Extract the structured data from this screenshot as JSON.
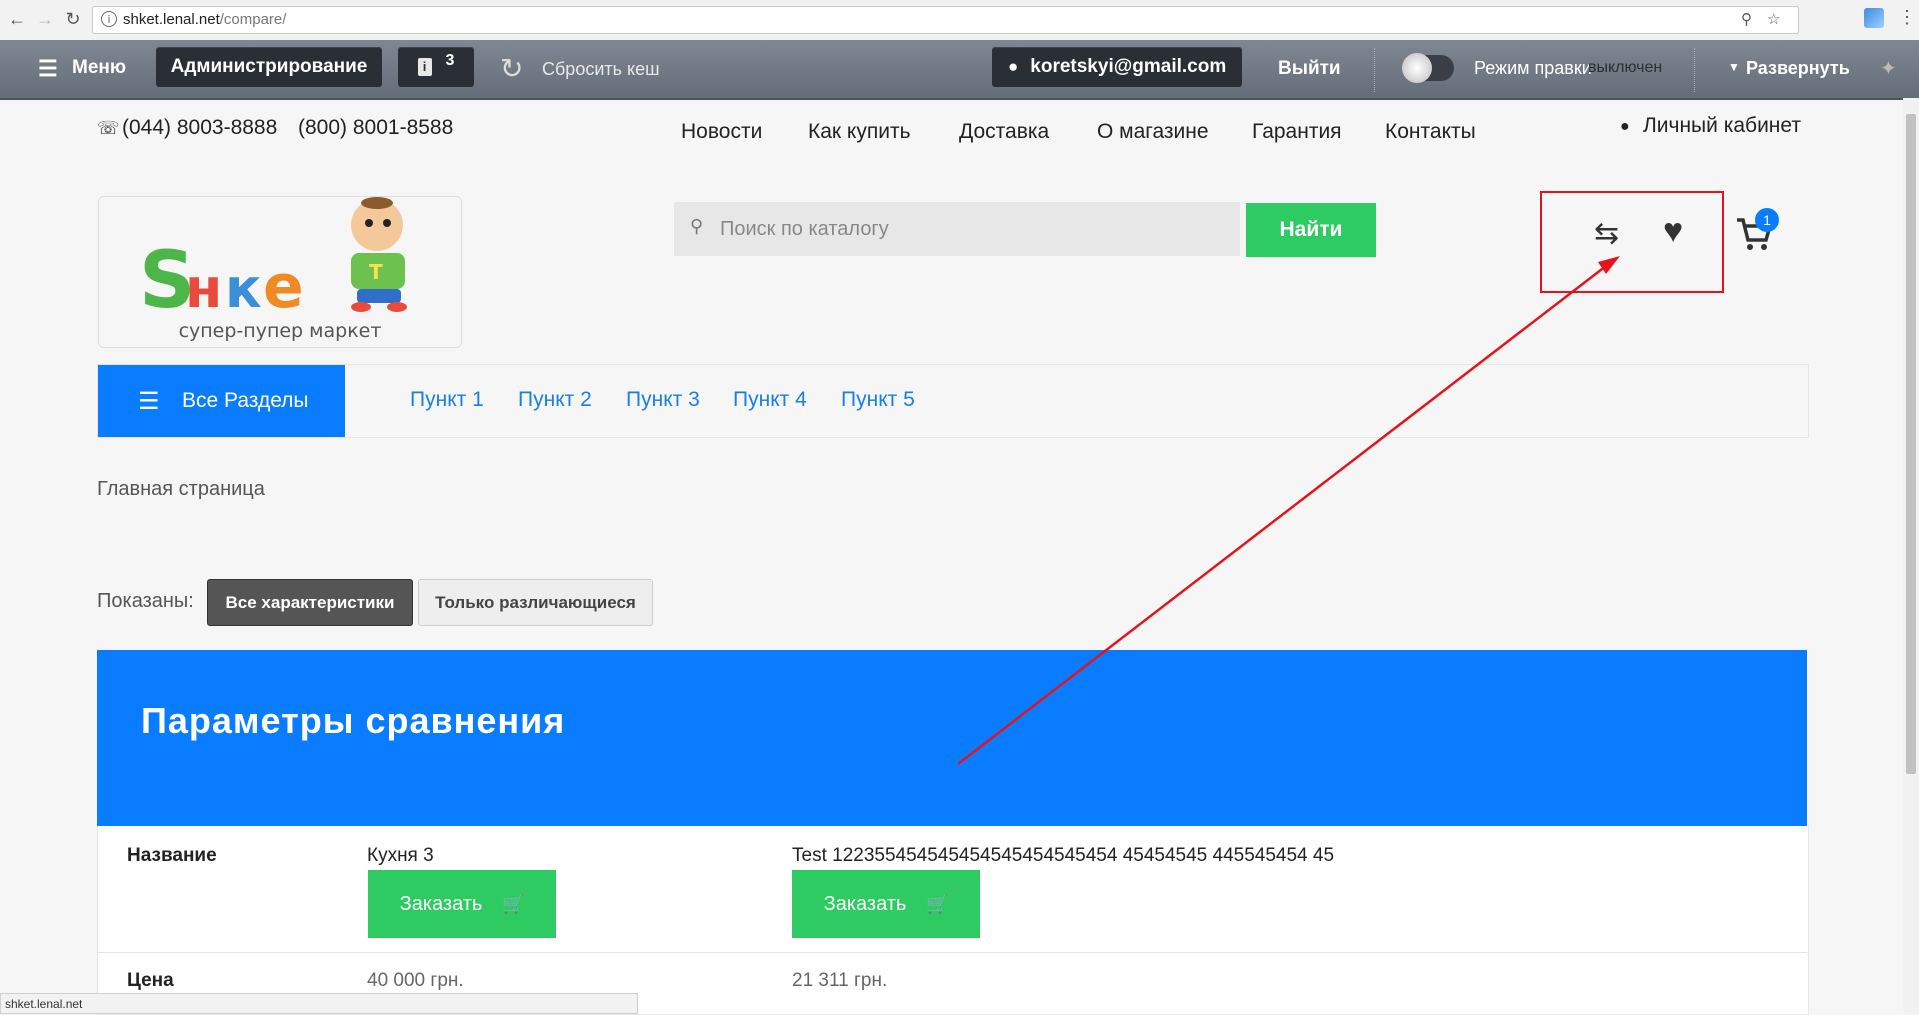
{
  "browser": {
    "url_host": "shket.lenal.net",
    "url_path": "/compare/",
    "status_url": "shket.lenal.net"
  },
  "admin_bar": {
    "menu_label": "Меню",
    "admin_label": "Администрирование",
    "notifications_count": "3",
    "reset_cache_label": "Сбросить кеш",
    "user_email": "koretskyi@gmail.com",
    "logout_label": "Выйти",
    "edit_mode_label": "Режим правки",
    "edit_mode_state": "выключен",
    "expand_label": "Развернуть"
  },
  "header": {
    "phone_1": "(044) 8003-8888",
    "phone_2": "(800) 8001-8588",
    "nav": [
      "Новости",
      "Как купить",
      "Доставка",
      "О магазине",
      "Гарантия",
      "Контакты"
    ],
    "cabinet_label": "Личный кабинет",
    "logo_tagline": "супер-пупер маркет",
    "search_placeholder": "Поиск по каталогу",
    "search_button": "Найти",
    "cart_count": "1"
  },
  "categories": {
    "all_label": "Все Разделы",
    "items": [
      "Пункт 1",
      "Пункт 2",
      "Пункт 3",
      "Пункт 4",
      "Пункт 5"
    ]
  },
  "breadcrumb": "Главная страница",
  "filters": {
    "shown_label": "Показаны:",
    "all_label": "Все характеристики",
    "diff_label": "Только различающиеся"
  },
  "compare": {
    "title": "Параметры сравнения",
    "name_label": "Название",
    "price_label": "Цена",
    "order_label": "Заказать",
    "products": [
      {
        "name": "Кухня 3",
        "price": "40 000 грн."
      },
      {
        "name": "Test 122355454545454545454545454 45454545 445545454 45",
        "price": "21 311 грн."
      }
    ]
  }
}
